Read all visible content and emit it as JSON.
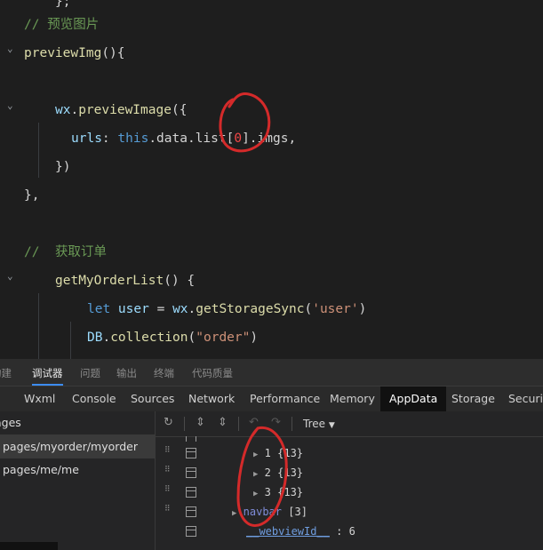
{
  "editor": {
    "fold_icon": "chevron-down-icon",
    "lines": {
      "l0": "};",
      "l1_comment_slashes": "//",
      "l1_comment_text": "预览图片",
      "l2_name": "previewImg",
      "l2_rest": "(){",
      "l4_obj": "wx",
      "l4_dot": ".",
      "l4_fn": "previewImage",
      "l4_rest": "({",
      "l5_key": "urls",
      "l5_colon": ": ",
      "l5_this": "this",
      "l5_path": ".data.list[",
      "l5_index": "0",
      "l5_tail": "].imgs,",
      "l6": "})",
      "l7": "},",
      "l9_comment_slashes": "//",
      "l9_comment_text": "获取订单",
      "l10_name": "getMyOrderList",
      "l10_rest": "() {",
      "l11_let": "let",
      "l11_var": " user",
      "l11_eq": " = ",
      "l11_obj": "wx",
      "l11_dot": ".",
      "l11_fn": "getStorageSync",
      "l11_open": "(",
      "l11_str": "'user'",
      "l11_close": ")",
      "l12_obj": "DB",
      "l12_dot": ".",
      "l12_fn": "collection",
      "l12_open": "(",
      "l12_str": "\"order\"",
      "l12_close": ")"
    }
  },
  "panel": {
    "top_tabs": [
      "构建",
      "调试器",
      "问题",
      "输出",
      "终端",
      "代码质量"
    ],
    "top_active": "调试器",
    "dev_tabs": [
      "Wxml",
      "Console",
      "Sources",
      "Network",
      "Performance",
      "Memory",
      "AppData",
      "Storage",
      "Security"
    ],
    "dev_active": "AppData",
    "pages_header": "Pages",
    "pages": [
      "pages/myorder/myorder",
      "pages/me/me"
    ],
    "selected_page": "pages/myorder/myorder",
    "toolbar": {
      "refresh_icon": "refresh-icon",
      "collapse_icon": "collapse-all-icon",
      "expand_icon": "expand-all-icon",
      "undo_icon": "undo-icon",
      "redo_icon": "redo-icon",
      "view_mode": "Tree",
      "dropdown_icon": "chevron-down-icon"
    },
    "tree": [
      {
        "index": "1",
        "value": "{13}"
      },
      {
        "index": "2",
        "value": "{13}"
      },
      {
        "index": "3",
        "value": "{13}"
      }
    ],
    "navbar_key": "navbar",
    "navbar_value": "[3]",
    "webview_key": "__webviewId__",
    "webview_sep": " : ",
    "webview_value": "6"
  },
  "colors": {
    "annotation": "#d42a2a",
    "accent": "#3c8cf0"
  }
}
